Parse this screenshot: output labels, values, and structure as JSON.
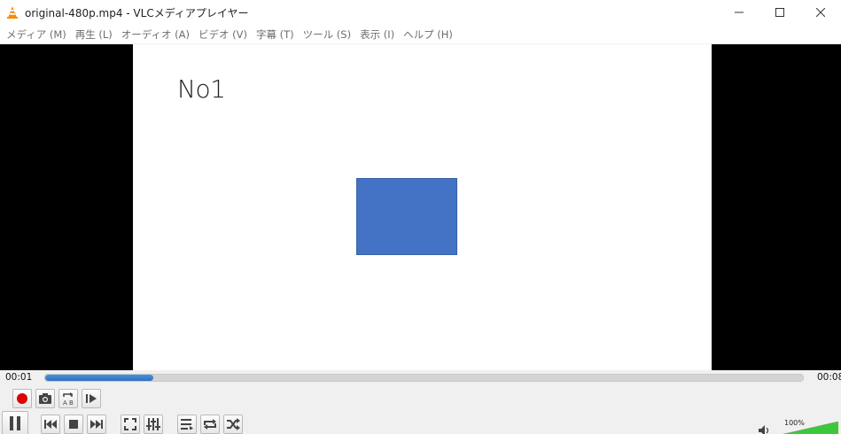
{
  "window": {
    "title": "original-480p.mp4 - VLCメディアプレイヤー"
  },
  "menu": [
    {
      "label": "メディア (M)"
    },
    {
      "label": "再生 (L)"
    },
    {
      "label": "オーディオ (A)"
    },
    {
      "label": "ビデオ (V)"
    },
    {
      "label": "字幕 (T)"
    },
    {
      "label": "ツール (S)"
    },
    {
      "label": "表示 (I)"
    },
    {
      "label": "ヘルプ (H)"
    }
  ],
  "video": {
    "frame_text": "No1"
  },
  "playback": {
    "elapsed": "00:01",
    "total": "00:08",
    "progress": 0.143
  },
  "volume": {
    "label": "100%",
    "level": 1.0
  },
  "colors": {
    "accent": "#2c6fc0",
    "record": "#e00000",
    "shape": "#4472c4",
    "volume": "#3cc83c"
  },
  "icons": {
    "app": "vlc-cone-icon",
    "record": "record-icon",
    "snapshot": "camera-icon",
    "loop_ab": "ab-loop-icon",
    "frame_step": "frame-step-icon",
    "pause": "pause-icon",
    "previous": "previous-icon",
    "stop": "stop-icon",
    "next": "next-icon",
    "fullscreen": "fullscreen-icon",
    "extended": "equalizer-icon",
    "playlist": "playlist-icon",
    "loop": "loop-icon",
    "shuffle": "shuffle-icon",
    "volume": "speaker-icon"
  }
}
